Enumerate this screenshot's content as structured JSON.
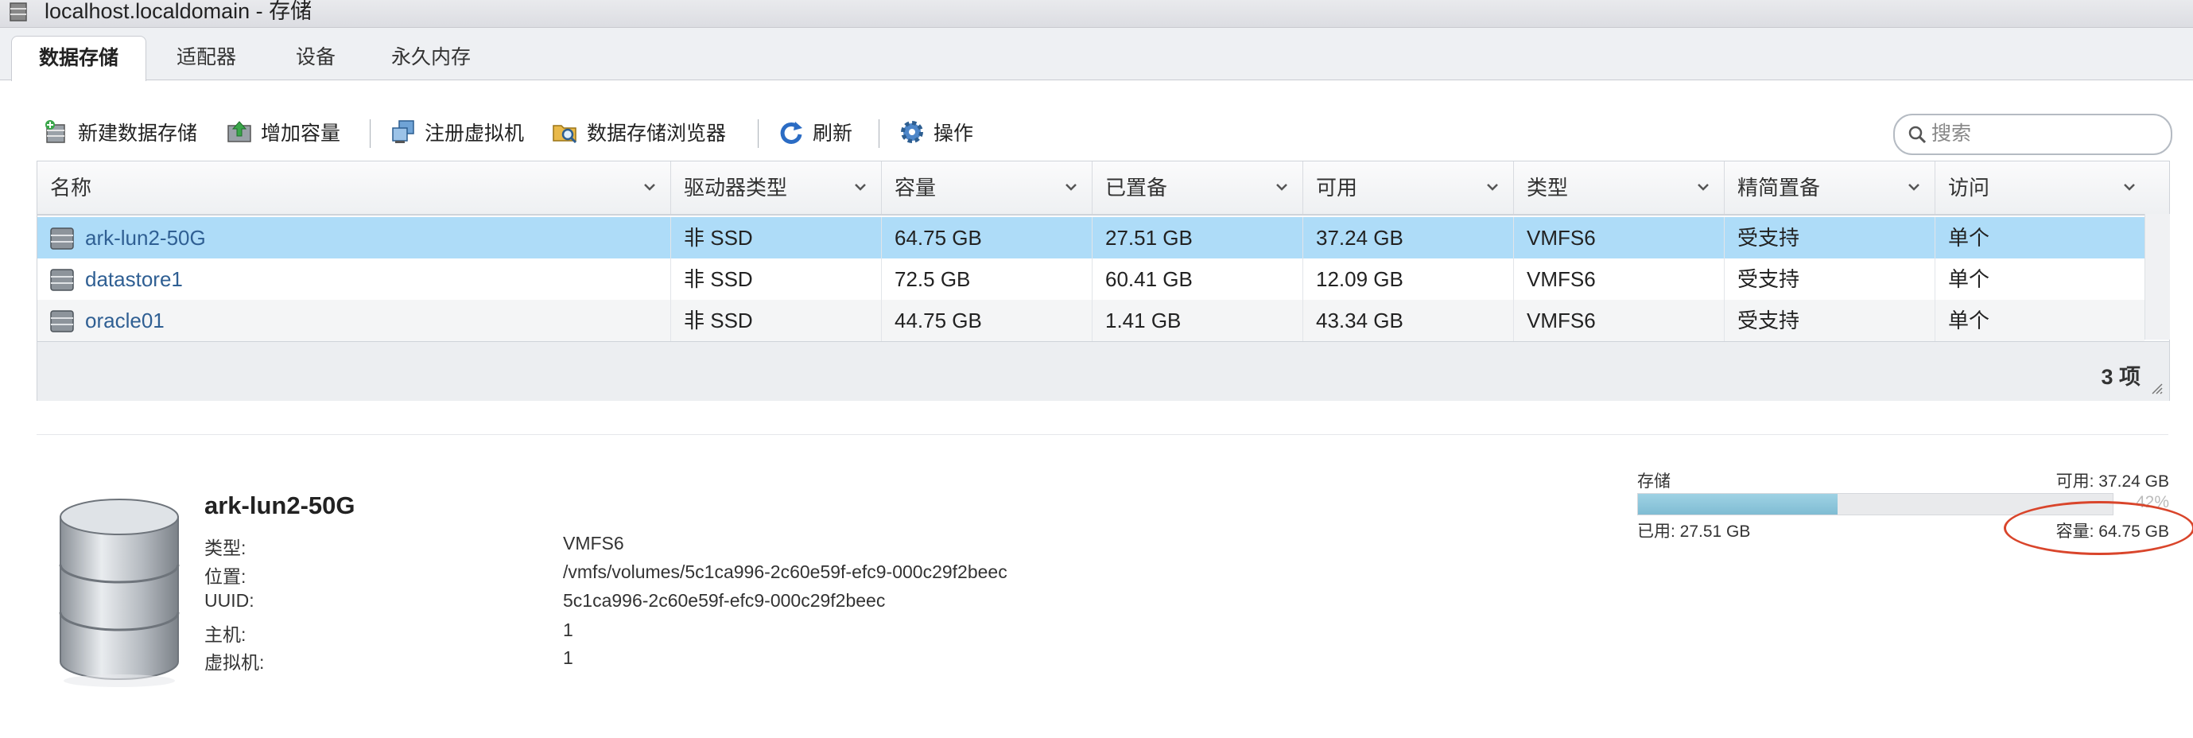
{
  "window": {
    "title": "localhost.localdomain - 存储"
  },
  "tabs": [
    {
      "label": "数据存储",
      "active": true
    },
    {
      "label": "适配器",
      "active": false
    },
    {
      "label": "设备",
      "active": false
    },
    {
      "label": "永久内存",
      "active": false
    }
  ],
  "toolbar": {
    "new_datastore": "新建数据存储",
    "increase_capacity": "增加容量",
    "register_vm": "注册虚拟机",
    "datastore_browser": "数据存储浏览器",
    "refresh": "刷新",
    "actions": "操作"
  },
  "search": {
    "placeholder": "搜索",
    "value": ""
  },
  "grid": {
    "columns": [
      "名称",
      "驱动器类型",
      "容量",
      "已置备",
      "可用",
      "类型",
      "精简置备",
      "访问"
    ],
    "rows": [
      {
        "name": "ark-lun2-50G",
        "drive": "非 SSD",
        "capacity": "64.75 GB",
        "provisioned": "27.51 GB",
        "free": "37.24 GB",
        "type": "VMFS6",
        "thin": "受支持",
        "access": "单个",
        "selected": true
      },
      {
        "name": "datastore1",
        "drive": "非 SSD",
        "capacity": "72.5 GB",
        "provisioned": "60.41 GB",
        "free": "12.09 GB",
        "type": "VMFS6",
        "thin": "受支持",
        "access": "单个",
        "selected": false
      },
      {
        "name": "oracle01",
        "drive": "非 SSD",
        "capacity": "44.75 GB",
        "provisioned": "1.41 GB",
        "free": "43.34 GB",
        "type": "VMFS6",
        "thin": "受支持",
        "access": "单个",
        "selected": false
      }
    ],
    "count": "3 项"
  },
  "details": {
    "title": "ark-lun2-50G",
    "fields": [
      {
        "label": "类型:",
        "value": "VMFS6"
      },
      {
        "label": "位置:",
        "value": "/vmfs/volumes/5c1ca996-2c60e59f-efc9-000c29f2beec"
      },
      {
        "label": "UUID:",
        "value": "5c1ca996-2c60e59f-efc9-000c29f2beec"
      },
      {
        "label": "主机:",
        "value": "1"
      },
      {
        "label": "虚拟机:",
        "value": "1"
      }
    ]
  },
  "storage": {
    "label": "存储",
    "free": "可用: 37.24 GB",
    "used": "已用: 27.51 GB",
    "capacity": "容量: 64.75 GB",
    "percent_text": "42%",
    "used_fraction": 0.42
  },
  "colors": {
    "selected_row": "#aedcf8",
    "link": "#2f5f93",
    "bar_fill": "#7fbcd3",
    "annotation": "#d9452b"
  }
}
